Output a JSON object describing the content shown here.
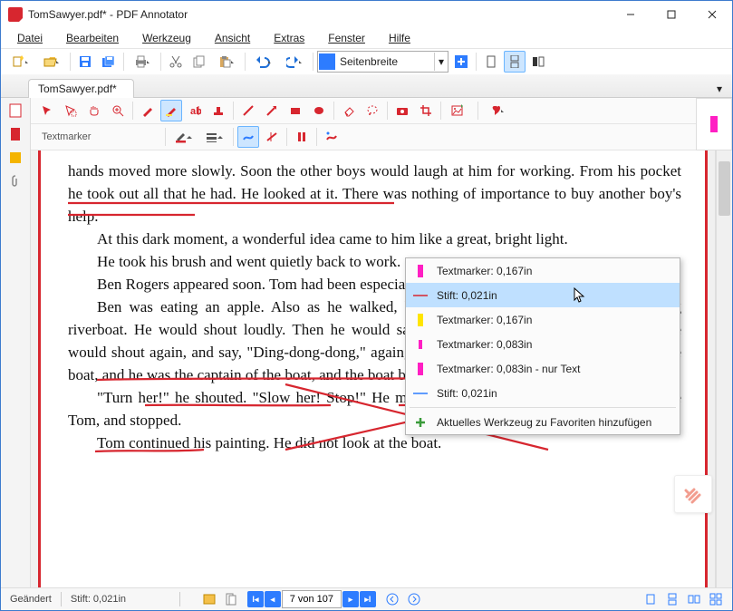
{
  "window": {
    "title": "TomSawyer.pdf* - PDF Annotator"
  },
  "menu": {
    "file": "Datei",
    "edit": "Bearbeiten",
    "tool": "Werkzeug",
    "view": "Ansicht",
    "extras": "Extras",
    "window": "Fenster",
    "help": "Hilfe"
  },
  "toolbar": {
    "zoom_combo": "Seitenbreite"
  },
  "tab": {
    "name": "TomSawyer.pdf*"
  },
  "ann": {
    "label": "Textmarker"
  },
  "dropdown": {
    "items": [
      {
        "label": "Textmarker: 0,167in"
      },
      {
        "label": "Stift: 0,021in"
      },
      {
        "label": "Textmarker: 0,167in"
      },
      {
        "label": "Textmarker: 0,083in"
      },
      {
        "label": "Textmarker: 0,083in - nur Text"
      },
      {
        "label": "Stift: 0,021in"
      }
    ],
    "add": "Aktuelles Werkzeug zu Favoriten hinzufügen"
  },
  "doc": {
    "p1": "hands moved more slowly. Soon the other boys would laugh at him for working. From his pocket he took out all that he had. He looked at it. There was nothing of importance to buy another boy's help.",
    "p2": "At this dark moment, a wonderful idea came to him like a great, bright light.",
    "p3": "He took his brush and went quietly back to work.",
    "p4": "Ben Rogers appeared soon. Tom had been especially afraid of Ben's laugh.",
    "p5": "Ben was eating an apple. Also as he walked, he was mak­ing nois­es like those of a big riverboat. He would shout loudly. Then he would say, \"Ding-dong-dong,\" like a bell. Then he would shout again, and say, \"Ding-dong-dong,\" again, and make other strange noises. He was the boat, and he was the captain of the boat, and the boat bell.",
    "p6": "\"Turn her!\" he shouted. \"Slow her! Stop!\" He made a slow, care­ful turn, came close beside Tom, and stopped.",
    "p7": "Tom continued his painting. He did not look at the boat."
  },
  "status": {
    "changed": "Geändert",
    "tool": "Stift: 0,021in",
    "page_of": "7 von 107"
  }
}
